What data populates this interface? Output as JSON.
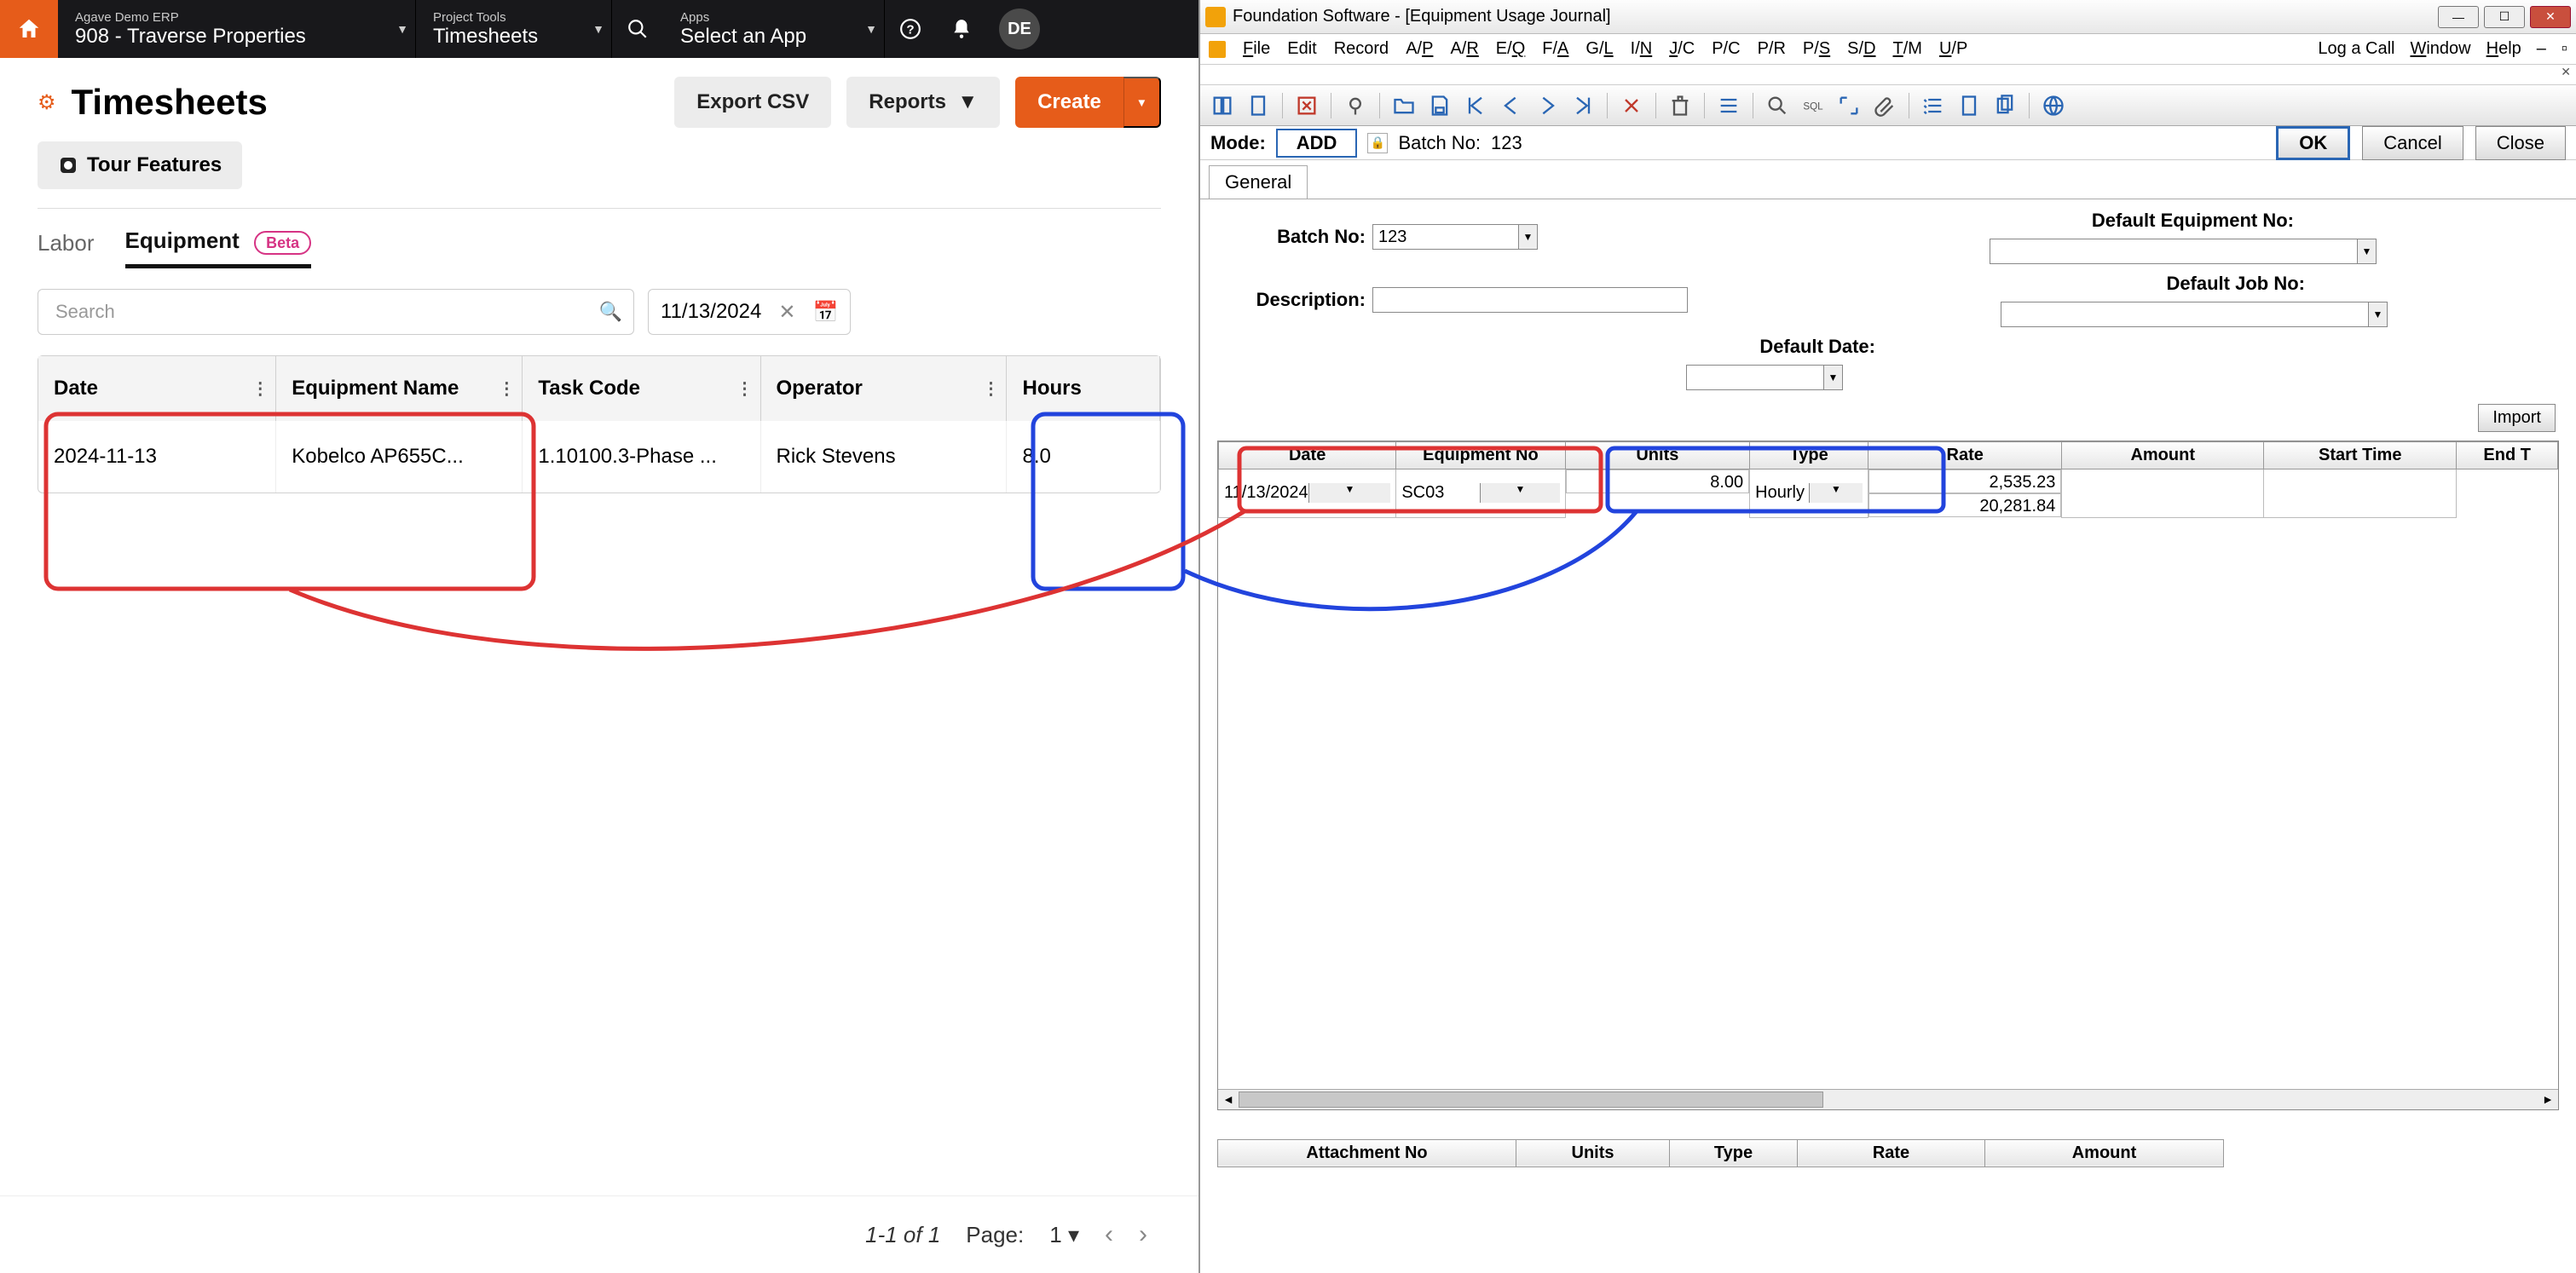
{
  "left": {
    "topbar": {
      "erp": {
        "small": "Agave Demo ERP",
        "big": "908 - Traverse Properties"
      },
      "tool": {
        "small": "Project Tools",
        "big": "Timesheets"
      },
      "apps": {
        "small": "Apps",
        "big": "Select an App"
      },
      "avatar": "DE"
    },
    "header": {
      "title": "Timesheets",
      "export": "Export CSV",
      "reports": "Reports",
      "create": "Create",
      "tour": "Tour Features"
    },
    "tabs": {
      "labor": "Labor",
      "equipment": "Equipment",
      "beta": "Beta"
    },
    "filters": {
      "search_placeholder": "Search",
      "date": "11/13/2024"
    },
    "table": {
      "headers": {
        "date": "Date",
        "equip": "Equipment Name",
        "task": "Task Code",
        "operator": "Operator",
        "hours": "Hours"
      },
      "row": {
        "date": "2024-11-13",
        "equip": "Kobelco AP655C...",
        "task": "1.10100.3-Phase ...",
        "operator": "Rick Stevens",
        "hours": "8.0"
      }
    },
    "pager": {
      "range": "1-1 of 1",
      "page_label": "Page:",
      "page": "1"
    }
  },
  "right": {
    "title": "Foundation Software - [Equipment Usage Journal]",
    "menu": [
      "File",
      "Edit",
      "Record",
      "A/P",
      "A/R",
      "E/Q",
      "F/A",
      "G/L",
      "I/N",
      "J/C",
      "P/C",
      "P/R",
      "P/S",
      "S/D",
      "T/M",
      "U/P"
    ],
    "menu_tail": [
      "Log a Call",
      "Window",
      "Help"
    ],
    "mode": {
      "label": "Mode:",
      "value": "ADD",
      "batch_label": "Batch No:",
      "batch": "123",
      "ok": "OK",
      "cancel": "Cancel",
      "close": "Close"
    },
    "tab": "General",
    "form": {
      "batch_no_label": "Batch No:",
      "batch_no": "123",
      "desc_label": "Description:",
      "desc": "",
      "def_equip_label": "Default Equipment No:",
      "def_equip": "",
      "def_job_label": "Default Job No:",
      "def_job": "",
      "def_date_label": "Default Date:",
      "def_date": "",
      "import": "Import"
    },
    "grid": {
      "headers": [
        "Date",
        "Equipment No",
        "Units",
        "Type",
        "Rate",
        "Amount",
        "Start Time",
        "End T"
      ],
      "row": {
        "date": "11/13/2024",
        "equip": "SC03",
        "units": "8.00",
        "type": "Hourly",
        "rate": "2,535.23",
        "amount": "20,281.84",
        "start": "",
        "end": ""
      }
    },
    "attach": {
      "headers": [
        "Attachment No",
        "Units",
        "Type",
        "Rate",
        "Amount"
      ]
    }
  }
}
